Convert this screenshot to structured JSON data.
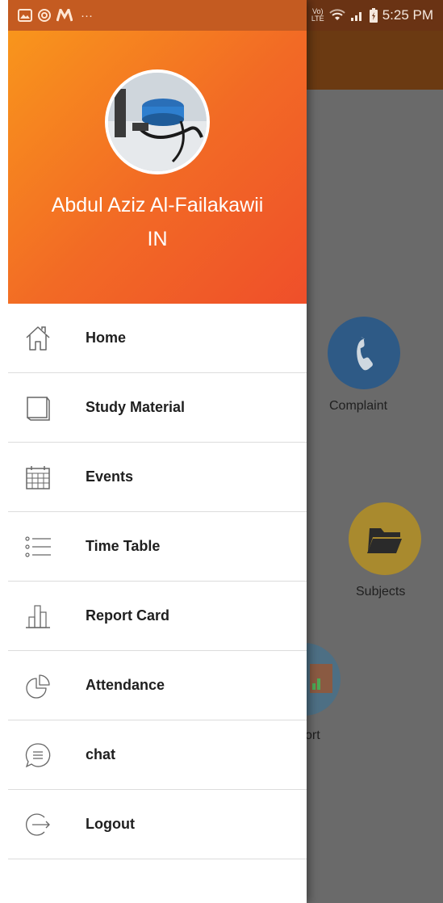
{
  "status_bar": {
    "time": "5:25 PM",
    "left_icons": [
      "gallery-icon",
      "at-icon",
      "m-icon"
    ],
    "more": "···",
    "network_top": "Vo)",
    "network_bottom": "LTE"
  },
  "profile": {
    "name": "Abdul Aziz Al-Failakawii",
    "subtitle": "IN"
  },
  "menu": {
    "items": [
      {
        "label": "Home",
        "icon": "home-icon"
      },
      {
        "label": "Study Material",
        "icon": "book-icon"
      },
      {
        "label": "Events",
        "icon": "calendar-icon"
      },
      {
        "label": "Time Table",
        "icon": "list-icon"
      },
      {
        "label": "Report Card",
        "icon": "bar-chart-icon"
      },
      {
        "label": "Attendance",
        "icon": "pie-chart-icon"
      },
      {
        "label": "chat",
        "icon": "chat-icon"
      },
      {
        "label": "Logout",
        "icon": "logout-icon"
      }
    ]
  },
  "background": {
    "complaint_label": "Complaint",
    "subjects_label": "Subjects",
    "report_label": "ort"
  },
  "colors": {
    "header_start": "#f99a1b",
    "header_end": "#ef4f2a",
    "complaint_circle": "#2e5a86",
    "subjects_circle": "#a98a2e",
    "report_circle": "#4d6f84"
  }
}
